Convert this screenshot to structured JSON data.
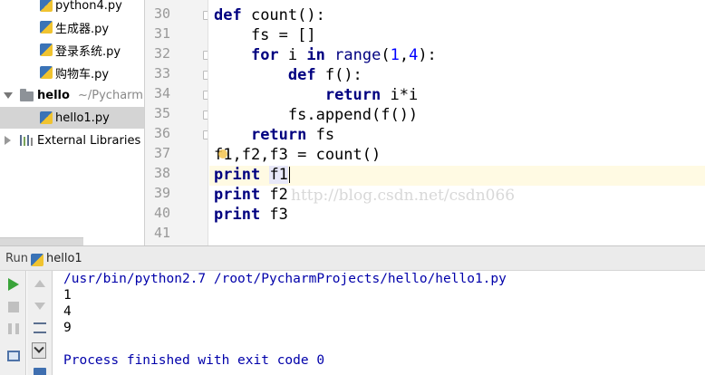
{
  "project_tree": {
    "items": [
      {
        "label": "python4.py",
        "icon": "python-file-icon"
      },
      {
        "label": "生成器.py",
        "icon": "python-file-icon"
      },
      {
        "label": "登录系统.py",
        "icon": "python-file-icon"
      },
      {
        "label": "购物车.py",
        "icon": "python-file-icon"
      },
      {
        "label": "hello",
        "sublabel": "~/PycharmP",
        "icon": "folder-icon",
        "expanded": true
      },
      {
        "label": "hello1.py",
        "icon": "python-file-icon",
        "selected": true
      },
      {
        "label": "External Libraries",
        "icon": "library-icon",
        "expanded": false
      }
    ]
  },
  "editor": {
    "line_numbers": [
      "30",
      "31",
      "32",
      "33",
      "34",
      "35",
      "36",
      "37",
      "38",
      "39",
      "40",
      "41"
    ],
    "current_line": "38",
    "code": {
      "l30_kw": "def",
      "l30_rest": " count():",
      "l31": "    fs = []",
      "l32_kw1": "for",
      "l32_i": " i ",
      "l32_kw2": "in",
      "l32_builtin": "range",
      "l32_open": "(",
      "l32_n1": "1",
      "l32_comma": ",",
      "l32_n2": "4",
      "l32_close": "):",
      "l33_kw": "def",
      "l33_rest": " f():",
      "l34_kw": "return",
      "l34_rest": " i*i",
      "l35": "        fs.append(f())",
      "l36_kw": "return",
      "l36_rest": " fs",
      "l37": "f1,f2,f3 = count()",
      "l38_kw": "print",
      "l38_rest": "f1",
      "l39_kw": "print",
      "l39_rest": " f2",
      "l40_kw": "print",
      "l40_rest": " f3"
    },
    "watermark": "http://blog.csdn.net/csdn066"
  },
  "run_panel": {
    "title": "Run",
    "config_name": "hello1",
    "output": [
      "/usr/bin/python2.7 /root/PycharmProjects/hello/hello1.py",
      "1",
      "4",
      "9",
      "",
      "Process finished with exit code 0"
    ]
  },
  "colors": {
    "keyword": "#000080",
    "number": "#0000ff",
    "caret_line": "#fffae3",
    "console_path": "#0000aa"
  }
}
